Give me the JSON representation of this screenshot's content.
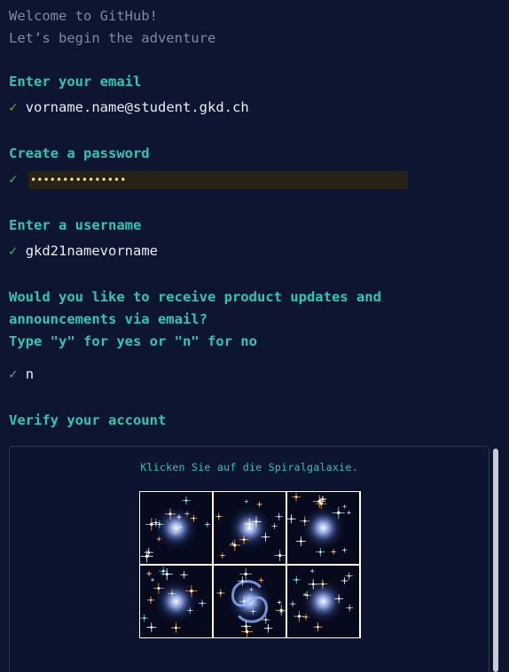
{
  "welcome": {
    "line1": "Welcome to GitHub!",
    "line2": "Let’s begin the adventure"
  },
  "email": {
    "prompt": "Enter your email",
    "check": "✓",
    "value": "vorname.name@student.gkd.ch"
  },
  "password": {
    "prompt": "Create a password",
    "check": "✓",
    "masked_value": "•••••••••••••••"
  },
  "username": {
    "prompt": "Enter a username",
    "check": "✓",
    "value": "gkd21namevorname"
  },
  "updates": {
    "prompt_line1": "Would you like to receive product updates and",
    "prompt_line2": "announcements via email?",
    "prompt_line3": "Type \"y\" for yes or \"n\" for no",
    "check": "✓",
    "value": "n"
  },
  "verify": {
    "prompt": "Verify your account",
    "captcha_instruction": "Klicken Sie auf die Spiralgalaxie.",
    "tiles": [
      {
        "icon": "star-cluster-icon"
      },
      {
        "icon": "star-cluster-icon"
      },
      {
        "icon": "star-cluster-icon"
      },
      {
        "icon": "star-cluster-icon"
      },
      {
        "icon": "spiral-galaxy-icon"
      },
      {
        "icon": "star-cluster-icon"
      }
    ]
  },
  "colors": {
    "background": "#0d1530",
    "prompt": "#2cc7b5",
    "muted": "#7e8aa3",
    "check": "#3fb950",
    "password_field": "#262216"
  }
}
